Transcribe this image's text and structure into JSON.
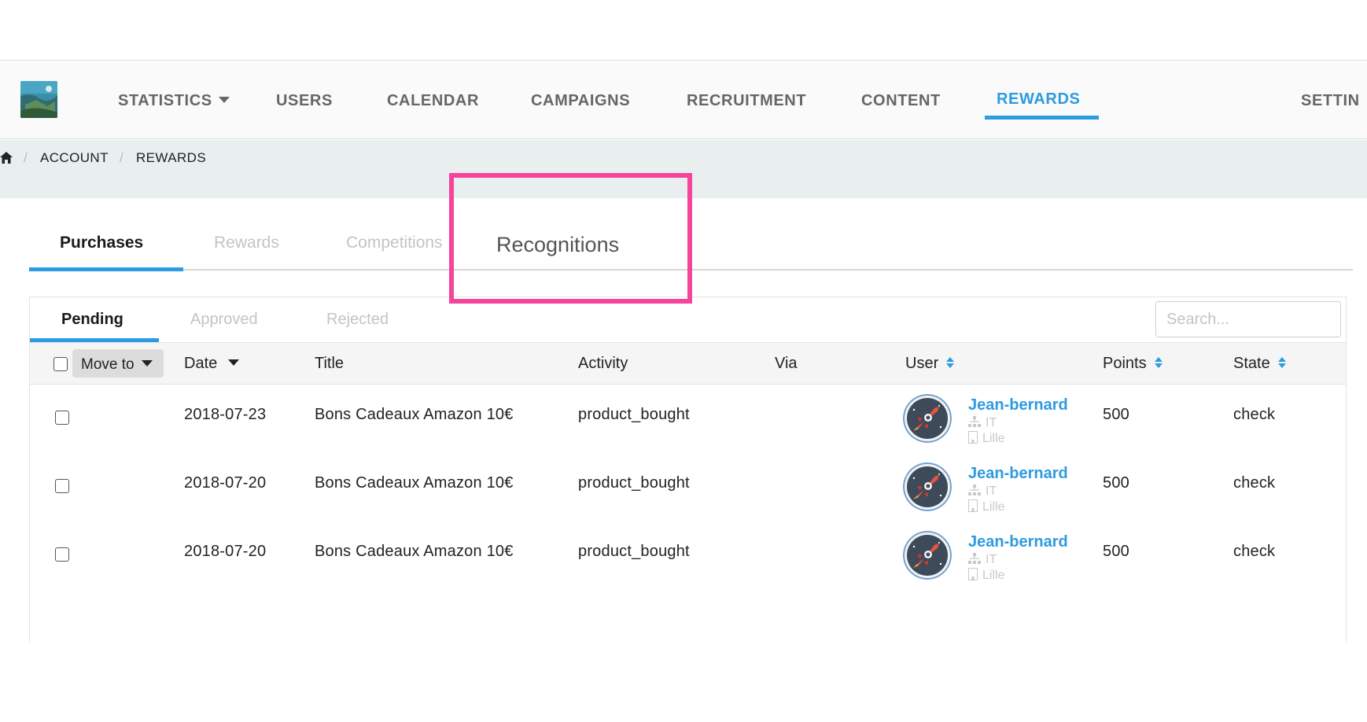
{
  "nav": {
    "items": [
      {
        "label": "STATISTICS",
        "has_dropdown": true
      },
      {
        "label": "USERS"
      },
      {
        "label": "CALENDAR"
      },
      {
        "label": "CAMPAIGNS"
      },
      {
        "label": "RECRUITMENT"
      },
      {
        "label": "CONTENT"
      },
      {
        "label": "REWARDS",
        "active": true
      },
      {
        "label": "SETTIN"
      }
    ],
    "accent_color": "#2d9be0"
  },
  "breadcrumb": {
    "icon": "home-icon",
    "items": [
      "ACCOUNT",
      "REWARDS"
    ],
    "separator": "/"
  },
  "tabs": {
    "items": [
      "Purchases",
      "Rewards",
      "Competitions",
      "Recognitions"
    ],
    "active": "Purchases",
    "highlighted": "Recognitions",
    "highlight_color": "#f4449c"
  },
  "subtabs": {
    "items": [
      "Pending",
      "Approved",
      "Rejected"
    ],
    "active": "Pending"
  },
  "search": {
    "placeholder": "Search..."
  },
  "table": {
    "move_to_label": "Move to",
    "columns": [
      "Date",
      "Title",
      "Activity",
      "Via",
      "User",
      "Points",
      "State"
    ],
    "rows": [
      {
        "date": "2018-07-23",
        "title": "Bons Cadeaux Amazon 10€",
        "activity": "product_bought",
        "via": "",
        "user": {
          "name": "Jean-bernard",
          "team": "IT",
          "site": "Lille"
        },
        "points": "500",
        "state": "check"
      },
      {
        "date": "2018-07-20",
        "title": "Bons Cadeaux Amazon 10€",
        "activity": "product_bought",
        "via": "",
        "user": {
          "name": "Jean-bernard",
          "team": "IT",
          "site": "Lille"
        },
        "points": "500",
        "state": "check"
      },
      {
        "date": "2018-07-20",
        "title": "Bons Cadeaux Amazon 10€",
        "activity": "product_bought",
        "via": "",
        "user": {
          "name": "Jean-bernard",
          "team": "IT",
          "site": "Lille"
        },
        "points": "500",
        "state": "check"
      }
    ]
  }
}
